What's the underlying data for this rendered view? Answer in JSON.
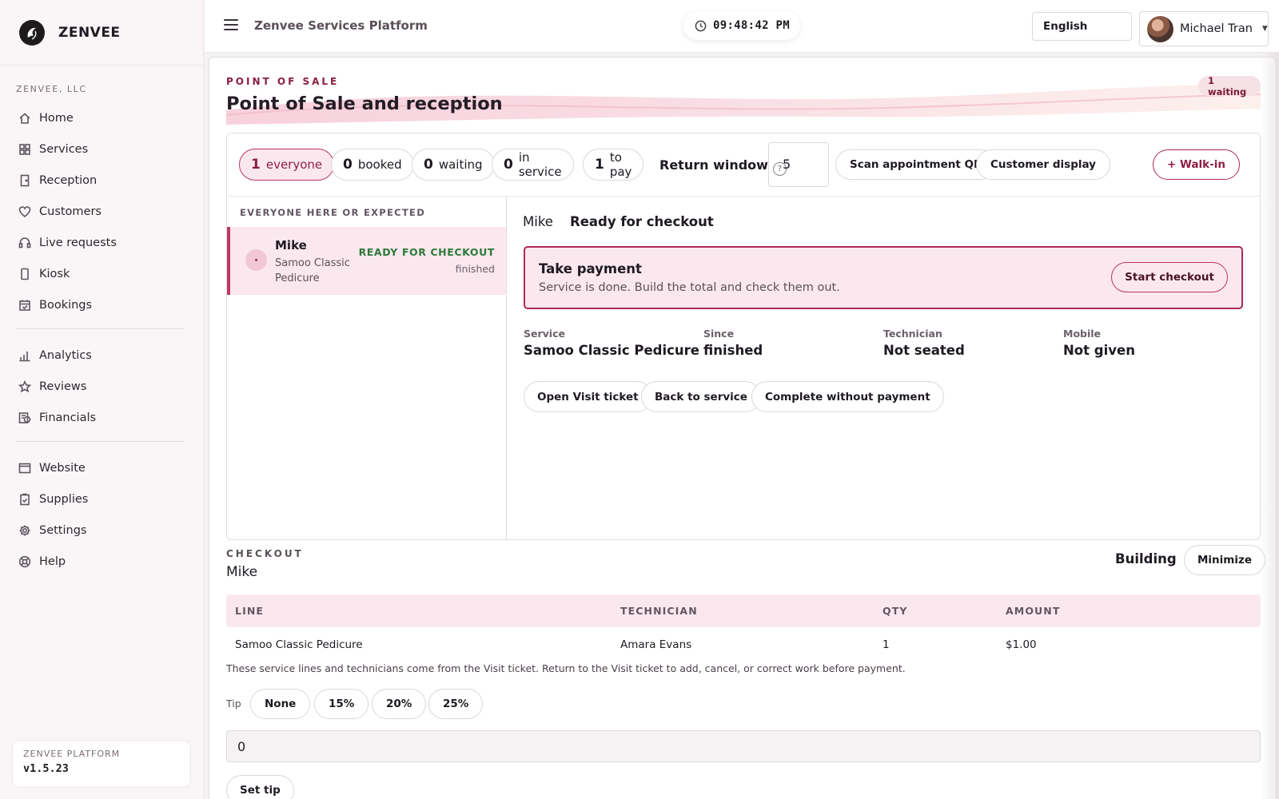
{
  "brand": {
    "name": "ZENVEE"
  },
  "sidebar": {
    "org": "ZENVEE, LLC",
    "groups": [
      [
        {
          "label": "Home",
          "icon": "home-icon"
        },
        {
          "label": "Services",
          "icon": "grid-icon"
        },
        {
          "label": "Reception",
          "icon": "door-icon"
        },
        {
          "label": "Customers",
          "icon": "heart-icon"
        },
        {
          "label": "Live requests",
          "icon": "headset-icon"
        },
        {
          "label": "Kiosk",
          "icon": "tablet-icon"
        },
        {
          "label": "Bookings",
          "icon": "calendar-icon"
        }
      ],
      [
        {
          "label": "Analytics",
          "icon": "bar-chart-icon"
        },
        {
          "label": "Reviews",
          "icon": "star-icon"
        },
        {
          "label": "Financials",
          "icon": "money-icon"
        }
      ],
      [
        {
          "label": "Website",
          "icon": "browser-icon"
        },
        {
          "label": "Supplies",
          "icon": "clipboard-icon"
        },
        {
          "label": "Settings",
          "icon": "gear-icon"
        },
        {
          "label": "Help",
          "icon": "lifebuoy-icon"
        }
      ]
    ],
    "version_label": "ZENVEE PLATFORM",
    "version": "v1.5.23"
  },
  "topbar": {
    "title": "Zenvee Services Platform",
    "clock": "09:48:42 PM",
    "language": "English",
    "user": "Michael Tran"
  },
  "header": {
    "eyebrow": "POINT OF SALE",
    "title": "Point of Sale and reception",
    "waiting_badge": "1 waiting"
  },
  "filters": [
    {
      "num": "1",
      "label": "everyone",
      "active": true
    },
    {
      "num": "0",
      "label": "booked",
      "active": false
    },
    {
      "num": "0",
      "label": "waiting",
      "active": false
    },
    {
      "num": "0",
      "label": "in service",
      "active": false
    },
    {
      "num": "1",
      "label": "to pay",
      "active": false
    }
  ],
  "return_window": {
    "label": "Return window",
    "help": "?",
    "value": "5"
  },
  "toolbar": {
    "scan_qr": "Scan appointment QR",
    "customer_display": "Customer display",
    "walk_in": "+ Walk-in"
  },
  "queue": {
    "heading": "EVERYONE HERE OR EXPECTED",
    "items": [
      {
        "name": "Mike",
        "service": "Samoo Classic Pedicure",
        "status": "READY FOR CHECKOUT",
        "state": "finished"
      }
    ]
  },
  "detail": {
    "name": "Mike",
    "status": "Ready for checkout",
    "pay_title": "Take payment",
    "pay_sub": "Service is done. Build the total and check them out.",
    "pay_button": "Start checkout",
    "facts": [
      {
        "k": "Service",
        "v": "Samoo Classic Pedicure"
      },
      {
        "k": "Since",
        "v": "finished"
      },
      {
        "k": "Technician",
        "v": "Not seated"
      },
      {
        "k": "Mobile",
        "v": "Not given"
      }
    ],
    "actions": [
      "Open Visit ticket",
      "Back to service",
      "Complete without payment"
    ]
  },
  "checkout": {
    "eyebrow": "CHECKOUT",
    "customer": "Mike",
    "state": "Building",
    "minimize": "Minimize",
    "columns": [
      "LINE",
      "TECHNICIAN",
      "QTY",
      "AMOUNT"
    ],
    "rows": [
      [
        "Samoo Classic Pedicure",
        "Amara Evans",
        "1",
        "$1.00"
      ]
    ],
    "note": "These service lines and technicians come from the Visit ticket. Return to the Visit ticket to add, cancel, or correct work before payment.",
    "tip_label": "Tip",
    "tip_options": [
      "None",
      "15%",
      "20%",
      "25%"
    ],
    "tip_value": "0",
    "set_tip": "Set tip"
  }
}
